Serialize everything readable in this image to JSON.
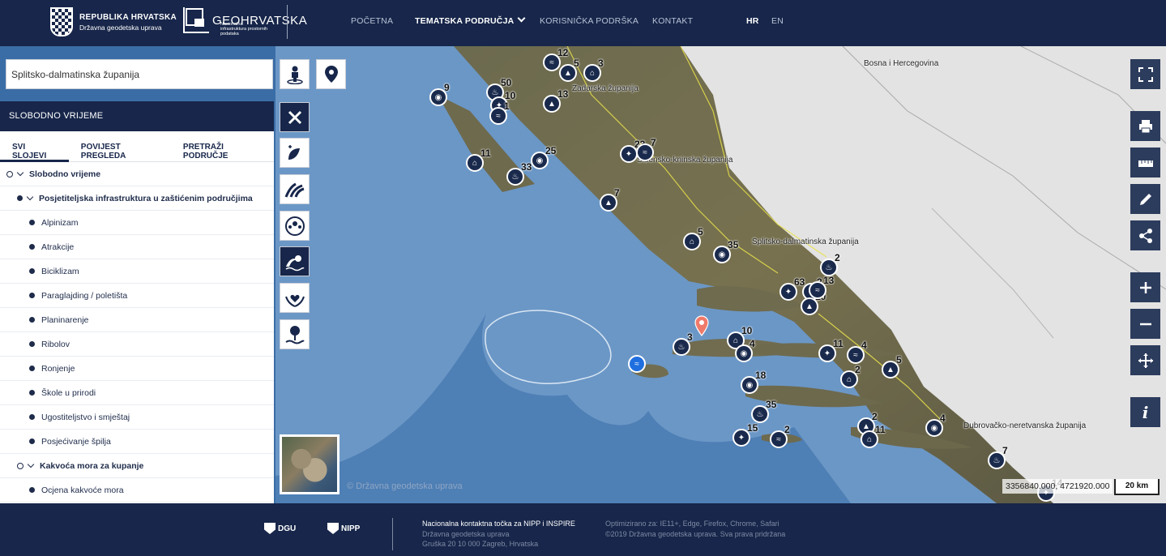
{
  "header": {
    "brand_rh_line1": "REPUBLIKA HRVATSKA",
    "brand_rh_line2": "Državna geodetska uprava",
    "brand_geo_title": "GEOHRVATSKA",
    "brand_geo_sub": "Nacionalna infrastruktura prostornih podataka",
    "nav": [
      "POČETNA",
      "TEMATSKA PODRUČJA",
      "KORISNIČKA PODRŠKA",
      "KONTAKT"
    ],
    "lang": [
      "HR",
      "EN"
    ]
  },
  "search": {
    "value": "Splitsko-dalmatinska županija"
  },
  "panel": {
    "title": "SLOBODNO VRIJEME",
    "tabs": [
      "SVI SLOJEVI",
      "POVIJEST PREGLEDA",
      "PRETRAŽI PODRUČJE"
    ],
    "tree": [
      {
        "label": "Slobodno vrijeme",
        "level": 0,
        "group": true
      },
      {
        "label": "Posjetiteljska infrastruktura u zaštićenim područjima",
        "level": 1,
        "group": true
      },
      {
        "label": "Alpinizam",
        "level": 2
      },
      {
        "label": "Atrakcije",
        "level": 2
      },
      {
        "label": "Biciklizam",
        "level": 2
      },
      {
        "label": "Paraglajding / poletišta",
        "level": 2
      },
      {
        "label": "Planinarenje",
        "level": 2
      },
      {
        "label": "Ribolov",
        "level": 2
      },
      {
        "label": "Ronjenje",
        "level": 2
      },
      {
        "label": "Škole u prirodi",
        "level": 2
      },
      {
        "label": "Ugostiteljstvo i smještaj",
        "level": 2
      },
      {
        "label": "Posjećivanje špilja",
        "level": 2
      },
      {
        "label": "Kakvoća mora za kupanje",
        "level": 1,
        "group": true,
        "ring": true
      },
      {
        "label": "Ocjena kakvoće mora",
        "level": 2
      }
    ]
  },
  "map": {
    "labels": [
      "Bosna i Hercegovina",
      "Zadarska županija",
      "Šibensko-kninska županija",
      "Splitsko-dalmatinska županija",
      "Dubrovačko-neretvanska županija"
    ],
    "copyright": "© Državna geodetska uprava",
    "coords": "3356840.000, 4721920.000",
    "scale": "20 km",
    "cluster_counts": [
      "12",
      "5",
      "3",
      "9",
      "50",
      "10",
      "1",
      "13",
      "11",
      "25",
      "33",
      "23",
      "7",
      "7",
      "5",
      "35",
      "2",
      "63",
      "2",
      "10",
      "10",
      "4",
      "3",
      "11",
      "4",
      "5",
      "2",
      "18",
      "35",
      "15",
      "2",
      "2",
      "11",
      "4",
      "7",
      "14",
      "13"
    ]
  },
  "colors": {
    "navy": "#17264a",
    "sea": "#4a7cb0",
    "land": "#e6e6e6"
  },
  "footer": {
    "dgu": "DGU",
    "nipp": "NIPP",
    "col1": [
      "Nacionalna kontaktna točka za NIPP i INSPIRE",
      "Državna geodetska uprava",
      "Gruška 20 10 000 Zagreb, Hrvatska"
    ],
    "col2": [
      "Optimizirano za: IE11+, Edge, Firefox, Chrome, Safari",
      "©2019 Državna geodetska uprava. Sva prava pridržana"
    ]
  }
}
